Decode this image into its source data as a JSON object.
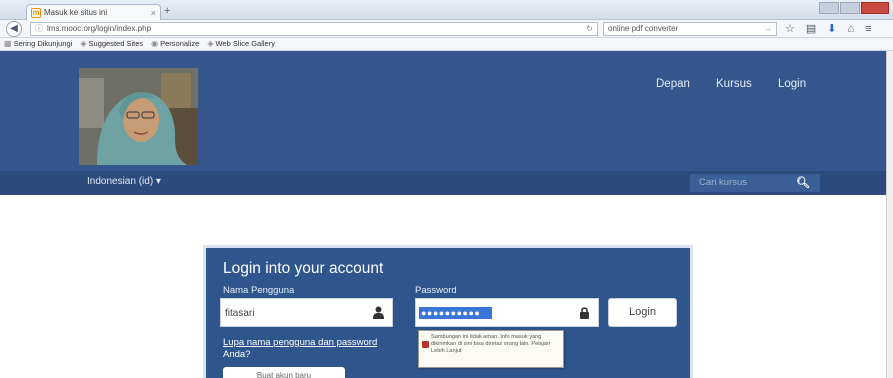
{
  "browser": {
    "tab_title": "Masuk ke situs ini",
    "tab_close": "×",
    "new_tab": "+",
    "url": "lms.mooc.org/login/index.php",
    "search_value": "online pdf converter",
    "bookmarks": [
      "Sering Dikunjungi",
      "Suggested Sites",
      "Personalize",
      "Web Slice Gallery"
    ]
  },
  "header": {
    "nav": [
      "Depan",
      "Kursus",
      "Login"
    ],
    "language": "Indonesian (id) ▾",
    "search_placeholder": "Cari kursus"
  },
  "login": {
    "title": "Login into your account",
    "username_label": "Nama Pengguna",
    "username_value": "fitasari",
    "password_label": "Password",
    "password_mask": "●●●●●●●●●●",
    "login_button": "Login",
    "forgot_link": "Lupa nama pengguna dan password",
    "forgot_suffix": "Anda?",
    "create_account": "Buat akun baru",
    "tooltip": "Sambungan ini tidak aman. Info masuk yang dikirimkan di sini bisa diretas orang lain. Pelajari Lebih Lanjut"
  },
  "colors": {
    "header_bg": "#34568c",
    "subbar_bg": "#2c4a7c",
    "panel_bg": "#2f558d",
    "password_highlight": "#3875d6"
  }
}
